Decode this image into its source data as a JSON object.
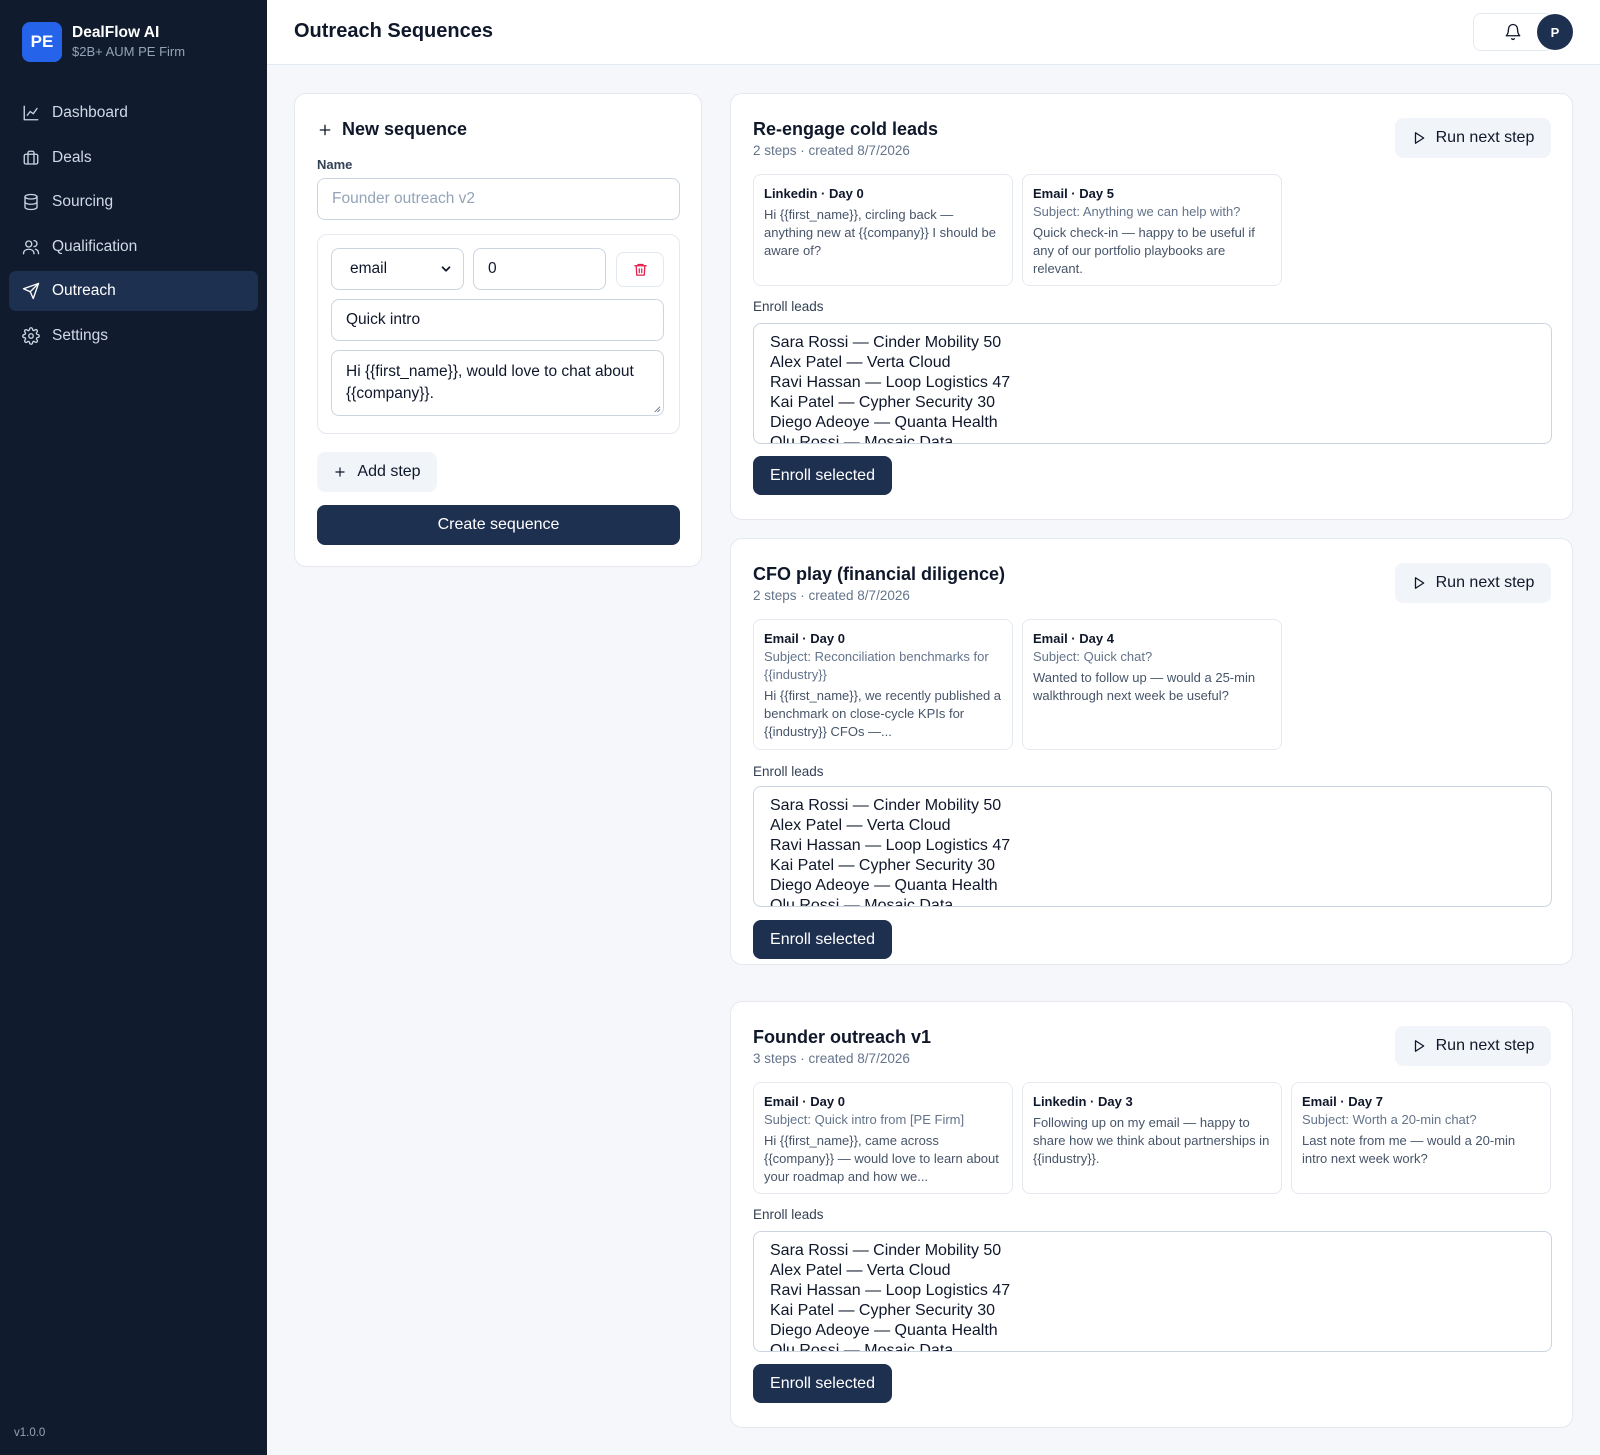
{
  "brand": {
    "logo": "PE",
    "name": "DealFlow AI",
    "subtitle": "$2B+ AUM PE Firm"
  },
  "sidebar": {
    "items": [
      {
        "label": "Dashboard",
        "icon": "chart-line-icon"
      },
      {
        "label": "Deals",
        "icon": "briefcase-icon"
      },
      {
        "label": "Sourcing",
        "icon": "database-icon"
      },
      {
        "label": "Qualification",
        "icon": "users-icon"
      },
      {
        "label": "Outreach",
        "icon": "send-icon",
        "active": true
      },
      {
        "label": "Settings",
        "icon": "gear-icon"
      }
    ],
    "version": "v1.0.0"
  },
  "header": {
    "title": "Outreach Sequences",
    "avatar": "P"
  },
  "new_sequence": {
    "title": "New sequence",
    "name_label": "Name",
    "name_placeholder": "Founder outreach v2",
    "step": {
      "channel": "email",
      "day": "0",
      "subject": "Quick intro",
      "body": "Hi {{first_name}}, would love to chat about {{company}}."
    },
    "add_step_label": "Add step",
    "create_label": "Create sequence"
  },
  "sequences": [
    {
      "title": "Re-engage cold leads",
      "meta": "2 steps · created 8/7/2026",
      "run_label": "Run next step",
      "steps": [
        {
          "head": "Linkedin · Day 0",
          "subject": "",
          "body": "Hi {{first_name}}, circling back — anything new at {{company}} I should be aware of?"
        },
        {
          "head": "Email · Day 5",
          "subject": "Subject: Anything we can help with?",
          "body": "Quick check-in — happy to be useful if any of our portfolio playbooks are relevant."
        }
      ],
      "enroll_label": "Enroll leads",
      "enroll_button": "Enroll selected"
    },
    {
      "title": "CFO play (financial diligence)",
      "meta": "2 steps · created 8/7/2026",
      "run_label": "Run next step",
      "steps": [
        {
          "head": "Email · Day 0",
          "subject": "Subject: Reconciliation benchmarks for {{industry}}",
          "body": "Hi {{first_name}}, we recently published a benchmark on close-cycle KPIs for {{industry}} CFOs —..."
        },
        {
          "head": "Email · Day 4",
          "subject": "Subject: Quick chat?",
          "body": "Wanted to follow up — would a 25-min walkthrough next week be useful?"
        }
      ],
      "enroll_label": "Enroll leads",
      "enroll_button": "Enroll selected"
    },
    {
      "title": "Founder outreach v1",
      "meta": "3 steps · created 8/7/2026",
      "run_label": "Run next step",
      "steps": [
        {
          "head": "Email · Day 0",
          "subject": "Subject: Quick intro from [PE Firm]",
          "body": "Hi {{first_name}}, came across {{company}} — would love to learn about your roadmap and how we..."
        },
        {
          "head": "Linkedin · Day 3",
          "subject": "",
          "body": "Following up on my email — happy to share how we think about partnerships in {{industry}}."
        },
        {
          "head": "Email · Day 7",
          "subject": "Subject: Worth a 20-min chat?",
          "body": "Last note from me — would a 20-min intro next week work?"
        }
      ],
      "enroll_label": "Enroll leads",
      "enroll_button": "Enroll selected"
    }
  ],
  "leads": [
    "Sara Rossi — Cinder Mobility 50",
    "Alex Patel — Verta Cloud",
    "Ravi Hassan — Loop Logistics 47",
    "Kai Patel — Cypher Security 30",
    "Diego Adeoye — Quanta Health",
    "Olu Rossi — Mosaic Data"
  ],
  "colors": {
    "sidebar": "#101b2e",
    "accent": "#2563eb",
    "primary_button": "#1e3050",
    "danger": "#e11d48"
  }
}
